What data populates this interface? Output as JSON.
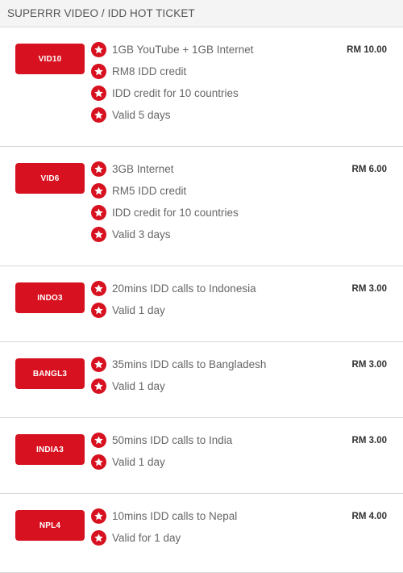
{
  "header": {
    "title": "SUPERRR VIDEO / IDD HOT TICKET"
  },
  "plans": [
    {
      "code": "VID10",
      "price": "RM 10.00",
      "features": [
        "1GB YouTube + 1GB Internet",
        "RM8 IDD credit",
        "IDD credit for 10 countries",
        "Valid 5 days"
      ]
    },
    {
      "code": "VID6",
      "price": "RM 6.00",
      "features": [
        "3GB Internet",
        "RM5 IDD credit",
        "IDD credit for 10 countries",
        "Valid 3 days"
      ]
    },
    {
      "code": "INDO3",
      "price": "RM 3.00",
      "features": [
        "20mins IDD calls to Indonesia",
        "Valid 1 day"
      ]
    },
    {
      "code": "BANGL3",
      "price": "RM 3.00",
      "features": [
        "35mins IDD calls to Bangladesh",
        "Valid 1 day"
      ]
    },
    {
      "code": "INDIA3",
      "price": "RM 3.00",
      "features": [
        "50mins IDD calls to India",
        "Valid 1 day"
      ]
    },
    {
      "code": "NPL4",
      "price": "RM 4.00",
      "features": [
        "10mins IDD calls to Nepal",
        "Valid for 1 day"
      ]
    }
  ],
  "colors": {
    "accent": "#d7111f",
    "header_bg": "#f4f4f4"
  },
  "icons": {
    "feature_bullet": "star-icon"
  }
}
